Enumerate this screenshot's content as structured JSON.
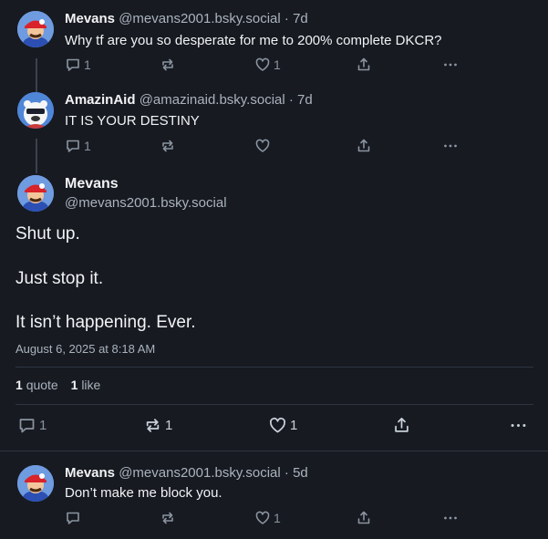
{
  "posts": [
    {
      "name": "Mevans",
      "handle": "@mevans2001.bsky.social",
      "dot": "·",
      "time": "7d",
      "text": "Why tf are you so desperate for me to 200% complete DKCR?",
      "reply_count": "1",
      "repost_count": "",
      "like_count": "1"
    },
    {
      "name": "AmazinAid",
      "handle": "@amazinaid.bsky.social",
      "dot": "·",
      "time": "7d",
      "text": "IT IS YOUR DESTINY",
      "reply_count": "1",
      "repost_count": "",
      "like_count": ""
    }
  ],
  "focused": {
    "name": "Mevans",
    "handle": "@mevans2001.bsky.social",
    "paragraphs": [
      "Shut up.",
      "Just stop it.",
      "It isn’t happening. Ever."
    ],
    "timestamp": "August 6, 2025 at 8:18 AM",
    "quote_count": "1",
    "quote_label": "quote",
    "like_count": "1",
    "like_label": "like",
    "reply_count": "1",
    "repost_count": "1",
    "like_action_count": "1"
  },
  "reply": {
    "name": "Mevans",
    "handle": "@mevans2001.bsky.social",
    "dot": "·",
    "time": "5d",
    "text": "Don’t make me block you.",
    "reply_count": "",
    "repost_count": "",
    "like_count": "1"
  },
  "colors": {
    "background": "#171a21",
    "muted": "#8a94a0",
    "text": "#f1f3f5"
  },
  "icons": [
    "reply-icon",
    "repost-icon",
    "like-icon",
    "share-icon",
    "more-icon"
  ]
}
